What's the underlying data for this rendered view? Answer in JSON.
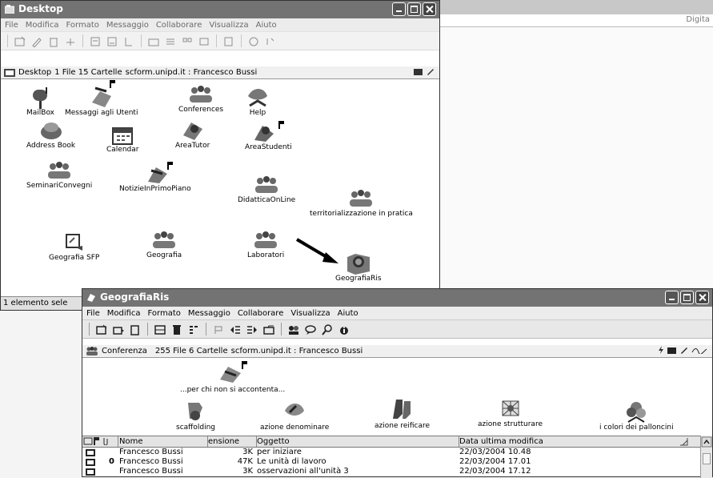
{
  "background_window": {
    "address_text": "Digita"
  },
  "desktop_window": {
    "title": "Desktop",
    "menu": [
      "File",
      "Modifica",
      "Formato",
      "Messaggio",
      "Collaborare",
      "Visualizza",
      "Aiuto"
    ],
    "info": {
      "location": "Desktop",
      "counts": "1 File 15 Cartelle",
      "server": "scform.unipd.it : Francesco Bussi"
    },
    "icons": [
      {
        "label": "MailBox",
        "icon": "mailbox-icon"
      },
      {
        "label": "Messaggi agli Utenti",
        "icon": "messages-icon"
      },
      {
        "label": "Conferences",
        "icon": "conference-group-icon"
      },
      {
        "label": "Help",
        "icon": "help-icon"
      },
      {
        "label": "Address Book",
        "icon": "address-book-icon"
      },
      {
        "label": "Calendar",
        "icon": "calendar-icon"
      },
      {
        "label": "AreaTutor",
        "icon": "tutor-icon"
      },
      {
        "label": "AreaStudenti",
        "icon": "students-icon"
      },
      {
        "label": "SeminariConvegni",
        "icon": "conference-group-icon"
      },
      {
        "label": "NotizieInPrimoPiano",
        "icon": "news-icon"
      },
      {
        "label": "DidatticaOnLine",
        "icon": "conference-group-icon"
      },
      {
        "label": "territorializzazione in pratica",
        "icon": "conference-group-icon"
      },
      {
        "label": "Geografia SFP",
        "icon": "document-icon"
      },
      {
        "label": "Geografia",
        "icon": "conference-group-icon"
      },
      {
        "label": "Laboratori",
        "icon": "conference-group-icon"
      },
      {
        "label": "GeografiaRis",
        "icon": "globe-folder-icon"
      }
    ],
    "status": "1 elemento sele"
  },
  "geo_window": {
    "title": "GeografiaRis",
    "menu": [
      "File",
      "Modifica",
      "Formato",
      "Messaggio",
      "Collaborare",
      "Visualizza",
      "Aiuto"
    ],
    "info": {
      "type": "Conferenza",
      "counts": "255 File 6 Cartelle",
      "server": "scform.unipd.it : Francesco Bussi"
    },
    "icons": [
      {
        "label": "...per chi non si accontenta...",
        "icon": "pen-paper-icon"
      },
      {
        "label": "scaffolding",
        "icon": "scaffolding-icon"
      },
      {
        "label": "azione denominare",
        "icon": "denominate-icon"
      },
      {
        "label": "azione reificare",
        "icon": "shoes-icon"
      },
      {
        "label": "azione strutturare",
        "icon": "web-icon"
      },
      {
        "label": "i colori dei palloncini",
        "icon": "balloons-icon"
      }
    ],
    "table": {
      "headers": [
        "Nome",
        "ensione",
        "Oggetto",
        "Data ultima modifica"
      ],
      "rows": [
        {
          "attach": "",
          "name": "Francesco Bussi",
          "size": "3K",
          "subject": "per iniziare",
          "date": "22/03/2004 10.48"
        },
        {
          "attach": "0",
          "name": "Francesco Bussi",
          "size": "47K",
          "subject": "Le unità di lavoro",
          "date": "22/03/2004 17.01"
        },
        {
          "attach": "",
          "name": "Francesco Bussi",
          "size": "3K",
          "subject": "osservazioni all'unità 3",
          "date": "22/03/2004 17.12"
        }
      ]
    }
  }
}
